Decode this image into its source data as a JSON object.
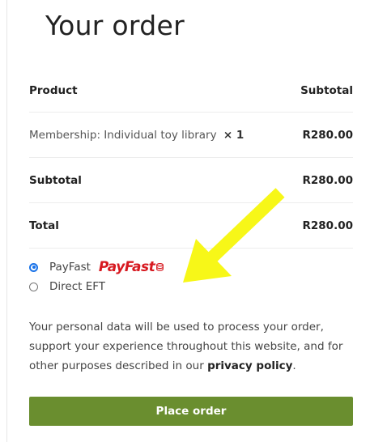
{
  "order": {
    "title": "Your order",
    "headers": {
      "product": "Product",
      "subtotal": "Subtotal"
    },
    "item": {
      "name": "Membership: Individual toy library",
      "qty": "× 1",
      "price": "R280.00"
    },
    "subtotal": {
      "label": "Subtotal",
      "value": "R280.00"
    },
    "total": {
      "label": "Total",
      "value": "R280.00"
    }
  },
  "payment": {
    "options": [
      {
        "label": "PayFast",
        "selected": true,
        "logo_text": "PayFast"
      },
      {
        "label": "Direct EFT",
        "selected": false
      }
    ]
  },
  "privacy": {
    "text": "Your personal data will be used to process your order, support your experience throughout this website, and for other purposes described in our",
    "link": "privacy policy",
    "end": "."
  },
  "place_order": {
    "label": "Place order",
    "color": "#6a8e2f"
  },
  "annotation": {
    "arrow_color": "#f7f718",
    "arrow_icon": "arrow-pointing-down-left"
  }
}
